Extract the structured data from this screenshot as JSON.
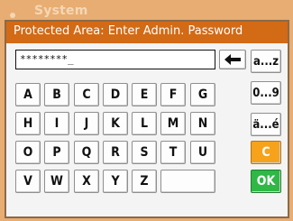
{
  "background": {
    "title": "System"
  },
  "dialog": {
    "title": "Protected Area: Enter Admin. Password"
  },
  "password_field": {
    "value": "********_"
  },
  "keyboard": {
    "row1": [
      "A",
      "B",
      "C",
      "D",
      "E",
      "F",
      "G"
    ],
    "row2": [
      "H",
      "I",
      "J",
      "K",
      "L",
      "M",
      "N"
    ],
    "row3": [
      "O",
      "P",
      "Q",
      "R",
      "S",
      "T",
      "U"
    ],
    "row4": [
      "V",
      "W",
      "X",
      "Y",
      "Z"
    ]
  },
  "side_keys": {
    "lowercase": "a...z",
    "digits": "0...9",
    "accents": "ä...é",
    "clear": "C",
    "ok": "OK"
  },
  "colors": {
    "header": "#d26a16",
    "clear_key": "#f7a21b",
    "ok_key": "#2fb845",
    "backdrop": "#e8ad72"
  }
}
